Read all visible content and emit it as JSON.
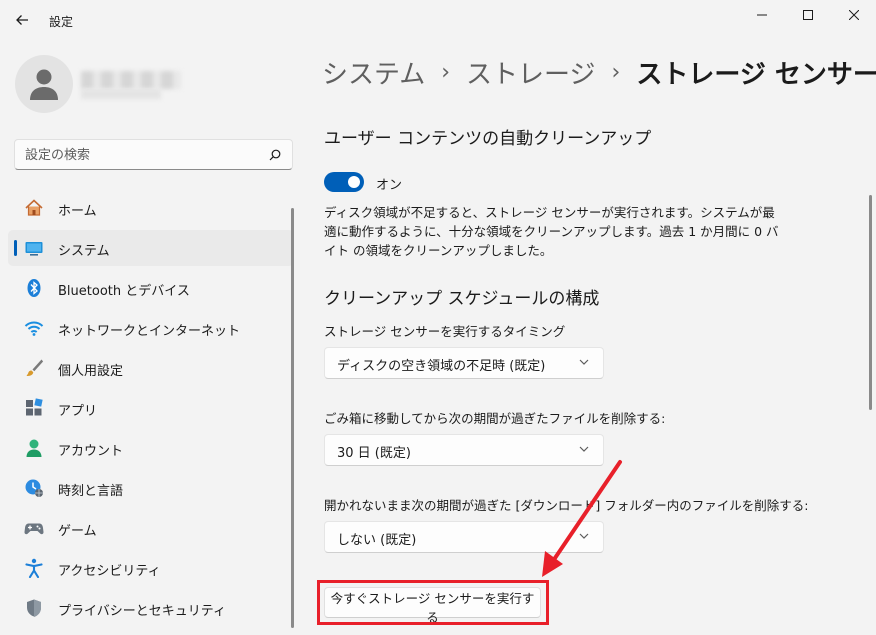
{
  "window": {
    "title": "設定"
  },
  "profile": {
    "avatar_icon": "person-icon"
  },
  "search": {
    "placeholder": "設定の検索"
  },
  "sidebar": {
    "items": [
      {
        "label": "ホーム",
        "icon": "home-icon"
      },
      {
        "label": "システム",
        "icon": "monitor-icon",
        "active": true
      },
      {
        "label": "Bluetooth とデバイス",
        "icon": "bluetooth-icon"
      },
      {
        "label": "ネットワークとインターネット",
        "icon": "wifi-icon"
      },
      {
        "label": "個人用設定",
        "icon": "brush-icon"
      },
      {
        "label": "アプリ",
        "icon": "apps-icon"
      },
      {
        "label": "アカウント",
        "icon": "account-icon"
      },
      {
        "label": "時刻と言語",
        "icon": "clock-globe-icon"
      },
      {
        "label": "ゲーム",
        "icon": "gamepad-icon"
      },
      {
        "label": "アクセシビリティ",
        "icon": "accessibility-icon"
      },
      {
        "label": "プライバシーとセキュリティ",
        "icon": "shield-icon"
      }
    ]
  },
  "breadcrumb": {
    "items": [
      "システム",
      "ストレージ"
    ],
    "separator": "›",
    "current": "ストレージ センサー"
  },
  "main": {
    "cleanup_title": "ユーザー コンテンツの自動クリーンアップ",
    "toggle_label": "オン",
    "toggle_on": true,
    "description": "ディスク領域が不足すると、ストレージ センサーが実行されます。システムが最適に動作するように、十分な領域をクリーンアップします。過去 1 か月間に 0 バイト の領域をクリーンアップしました。",
    "schedule_title": "クリーンアップ スケジュールの構成",
    "timing_label": "ストレージ センサーを実行するタイミング",
    "timing_value": "ディスクの空き領域の不足時 (既定)",
    "recycle_label": "ごみ箱に移動してから次の期間が過ぎたファイルを削除する:",
    "recycle_value": "30 日 (既定)",
    "downloads_label": "開かれないまま次の期間が過ぎた [ダウンロード] フォルダー内のファイルを削除する:",
    "downloads_value": "しない (既定)",
    "run_button": "今すぐストレージ センサーを実行する"
  },
  "colors": {
    "accent": "#005fb8",
    "annotation": "#e8202a"
  }
}
